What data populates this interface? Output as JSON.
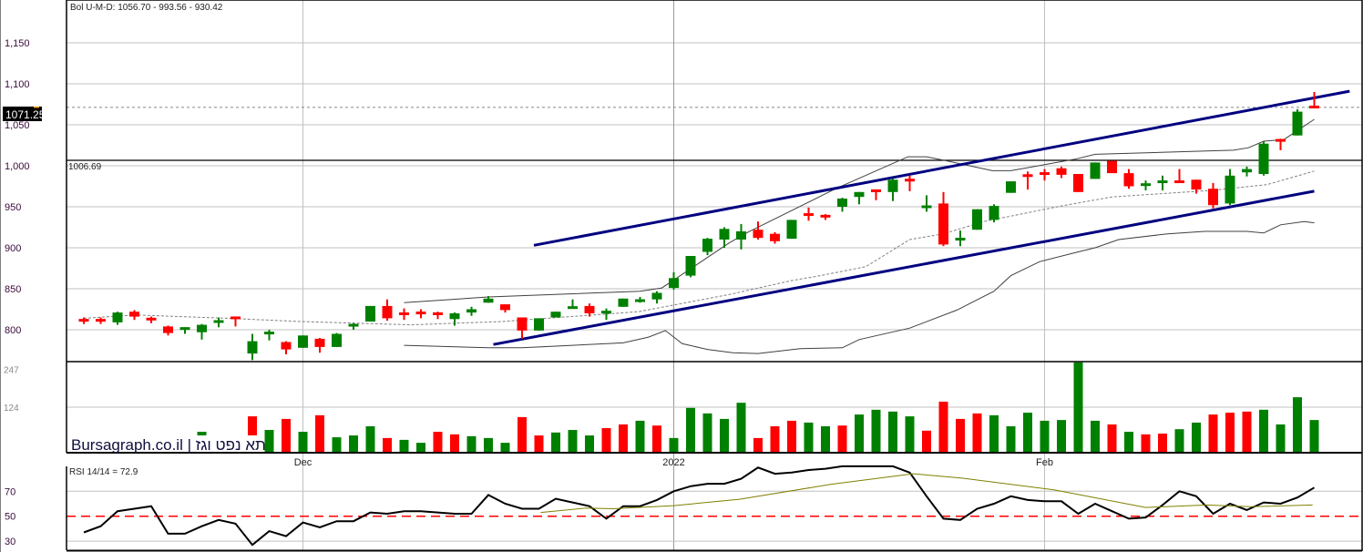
{
  "chart_data": {
    "type": "candlestick",
    "header_label": "Bol U-M-D: 1056.70 - 993.56 - 930.42",
    "watermark": "Bursagraph.co.il | תא נפט וגז",
    "last_price_label": "1071.25",
    "last_price": 1071.25,
    "reference_line_label": "1006.69",
    "reference_line": 1006.69,
    "price_axis": {
      "ylim": [
        761,
        1202
      ],
      "ticks": [
        800,
        850,
        900,
        950,
        1000,
        1050,
        1100,
        1150
      ],
      "tick_labels": [
        "800",
        "850",
        "900",
        "950",
        "1,000",
        "1,050",
        "1,100",
        "1,150"
      ],
      "grid": true
    },
    "x_labels": [
      {
        "index": 14,
        "label": "Dec"
      },
      {
        "index": 36,
        "label": "2022"
      },
      {
        "index": 58,
        "label": "Feb"
      }
    ],
    "ohlc": [
      [
        812,
        815,
        807,
        811
      ],
      [
        812,
        815,
        807,
        811
      ],
      [
        809,
        822,
        806,
        821
      ],
      [
        822,
        824,
        812,
        816
      ],
      [
        814,
        816,
        808,
        812
      ],
      [
        804,
        805,
        793,
        796
      ],
      [
        800,
        803,
        795,
        803
      ],
      [
        797,
        807,
        788,
        806
      ],
      [
        809,
        815,
        803,
        811
      ],
      [
        815,
        815,
        804,
        814
      ],
      [
        771,
        795,
        763,
        786
      ],
      [
        795,
        800,
        787,
        797
      ],
      [
        785,
        786,
        770,
        776
      ],
      [
        778,
        793,
        778,
        793
      ],
      [
        789,
        790,
        772,
        779
      ],
      [
        779,
        796,
        779,
        795
      ],
      [
        804,
        808,
        800,
        807
      ],
      [
        810,
        829,
        810,
        829
      ],
      [
        829,
        837,
        811,
        814
      ],
      [
        820,
        826,
        812,
        819
      ],
      [
        821,
        825,
        814,
        820
      ],
      [
        820,
        822,
        813,
        819
      ],
      [
        813,
        821,
        805,
        820
      ],
      [
        821,
        828,
        817,
        825
      ],
      [
        833,
        841,
        833,
        838
      ],
      [
        831,
        831,
        821,
        824
      ],
      [
        815,
        815,
        789,
        799
      ],
      [
        799,
        814,
        799,
        814
      ],
      [
        815,
        822,
        815,
        822
      ],
      [
        826,
        837,
        826,
        828
      ],
      [
        829,
        832,
        816,
        820
      ],
      [
        821,
        826,
        812,
        822
      ],
      [
        828,
        838,
        828,
        838
      ],
      [
        835,
        840,
        833,
        836
      ],
      [
        837,
        847,
        832,
        845
      ],
      [
        851,
        870,
        849,
        863
      ],
      [
        866,
        890,
        864,
        890
      ],
      [
        895,
        912,
        891,
        911
      ],
      [
        910,
        925,
        900,
        923
      ],
      [
        910,
        929,
        898,
        920
      ],
      [
        922,
        932,
        910,
        912
      ],
      [
        917,
        919,
        905,
        908
      ],
      [
        911,
        934,
        911,
        934
      ],
      [
        941,
        949,
        933,
        940
      ],
      [
        939,
        941,
        934,
        938
      ],
      [
        950,
        961,
        944,
        960
      ],
      [
        962,
        968,
        953,
        968
      ],
      [
        971,
        971,
        958,
        968
      ],
      [
        968,
        984,
        957,
        983
      ],
      [
        984,
        988,
        969,
        981
      ],
      [
        949,
        964,
        944,
        951
      ],
      [
        954,
        968,
        902,
        904
      ],
      [
        909,
        921,
        902,
        912
      ],
      [
        922,
        947,
        922,
        947
      ],
      [
        934,
        953,
        931,
        951
      ],
      [
        967,
        981,
        967,
        981
      ],
      [
        989,
        993,
        971,
        987
      ],
      [
        992,
        996,
        982,
        989
      ],
      [
        997,
        999,
        985,
        989
      ],
      [
        990,
        990,
        968,
        968
      ],
      [
        984,
        1004,
        984,
        1004
      ],
      [
        1006,
        1006,
        991,
        991
      ],
      [
        991,
        996,
        972,
        975
      ],
      [
        976,
        982,
        970,
        978
      ],
      [
        979,
        988,
        970,
        982
      ],
      [
        982,
        996,
        979,
        979
      ],
      [
        983,
        983,
        966,
        971
      ],
      [
        972,
        979,
        948,
        952
      ],
      [
        954,
        996,
        952,
        988
      ],
      [
        992,
        999,
        987,
        996
      ],
      [
        990,
        1030,
        988,
        1027
      ],
      [
        1032,
        1033,
        1019,
        1030
      ],
      [
        1037,
        1069,
        1037,
        1066
      ],
      [
        1072,
        1090,
        1071,
        1071.25
      ]
    ],
    "bollinger": {
      "upper": [
        [
          20,
          833
        ],
        [
          25,
          840
        ],
        [
          34,
          847
        ],
        [
          35.3,
          851
        ],
        [
          39.3,
          906
        ],
        [
          40.4,
          919
        ],
        [
          45.6,
          972
        ],
        [
          49.9,
          1011
        ],
        [
          51,
          1011
        ],
        [
          52.2,
          1006
        ],
        [
          54.9,
          994
        ],
        [
          56,
          994
        ],
        [
          59.8,
          1008
        ],
        [
          61,
          1014
        ],
        [
          69.2,
          1019
        ],
        [
          70.1,
          1022
        ],
        [
          71,
          1030
        ],
        [
          72.2,
          1032
        ],
        [
          74,
          1056.7
        ]
      ],
      "middle": [
        [
          1,
          814
        ],
        [
          4.1,
          818
        ],
        [
          9.5,
          814
        ],
        [
          13.9,
          810
        ],
        [
          20.4,
          806
        ],
        [
          25.8,
          810
        ],
        [
          33.9,
          822
        ],
        [
          39.3,
          843
        ],
        [
          43,
          860
        ],
        [
          44.7,
          866
        ],
        [
          47.4,
          877
        ],
        [
          50,
          910
        ],
        [
          52,
          917
        ],
        [
          54.4,
          932
        ],
        [
          59,
          951
        ],
        [
          62,
          962
        ],
        [
          67.9,
          970
        ],
        [
          71.2,
          977
        ],
        [
          74,
          993.56
        ]
      ],
      "lower": [
        [
          20,
          781
        ],
        [
          25,
          778
        ],
        [
          27,
          778
        ],
        [
          33,
          784
        ],
        [
          34.5,
          791
        ],
        [
          35.5,
          799
        ],
        [
          36.5,
          783
        ],
        [
          38,
          776
        ],
        [
          39.5,
          772
        ],
        [
          41,
          771
        ],
        [
          43.5,
          777
        ],
        [
          46,
          778
        ],
        [
          47,
          788
        ],
        [
          50,
          802
        ],
        [
          52.8,
          824
        ],
        [
          55,
          847
        ],
        [
          56,
          866
        ],
        [
          57.7,
          883
        ],
        [
          60,
          895
        ],
        [
          61,
          900
        ],
        [
          62.4,
          910
        ],
        [
          65.3,
          917
        ],
        [
          67.5,
          920
        ],
        [
          70,
          920
        ],
        [
          71,
          918
        ],
        [
          72,
          928
        ],
        [
          73.4,
          932
        ],
        [
          74,
          930.42
        ]
      ]
    },
    "trend_channel": {
      "upper": [
        [
          27.7,
          903
        ],
        [
          76.1,
          1091
        ]
      ],
      "lower": [
        [
          25.3,
          782
        ],
        [
          74,
          969
        ]
      ]
    },
    "volume": {
      "ticks": [
        124,
        247
      ],
      "tick_labels": [
        "124",
        "247"
      ],
      "values": [
        null,
        null,
        null,
        null,
        null,
        null,
        null,
        57,
        null,
        null,
        99,
        62,
        92,
        57,
        102,
        42,
        47,
        72,
        40,
        35,
        27,
        57,
        50,
        45,
        40,
        27,
        97,
        47,
        55,
        62,
        47,
        67,
        77,
        87,
        74,
        40,
        122,
        107,
        92,
        136,
        40,
        72,
        87,
        82,
        72,
        74,
        104,
        117,
        112,
        99,
        60,
        139,
        92,
        107,
        102,
        72,
        109,
        87,
        89,
        246,
        87,
        77,
        57,
        50,
        52,
        64,
        82,
        104,
        109,
        112,
        117,
        77,
        151,
        89
      ],
      "direction": "uuuuuuuuuudududuuuduudduuudduuudduduuuuuddduuduuuudddduuuuuuududduuddduuuuuu"
    },
    "rsi": {
      "label": "RSI 14/14 = 72.9",
      "ticks": [
        30,
        50,
        70
      ],
      "tick_labels": [
        "30",
        "50",
        "70"
      ],
      "ylim": [
        21,
        96
      ],
      "values": [
        37,
        42,
        54,
        56,
        58,
        36,
        36,
        42,
        47,
        44,
        27,
        38,
        34,
        45,
        41,
        46,
        46,
        53,
        52,
        54,
        54,
        53,
        52,
        52,
        67,
        60,
        56,
        56,
        64,
        61,
        58,
        48,
        58,
        58,
        63,
        70,
        74,
        76,
        76,
        80,
        89,
        84,
        85,
        87,
        88,
        90,
        90,
        90,
        90,
        85,
        66,
        48,
        47,
        56,
        60,
        66,
        63,
        62,
        62,
        52,
        60,
        54,
        48,
        49,
        59,
        70,
        66,
        52,
        60,
        55,
        61,
        60,
        65,
        72.9
      ],
      "signal": [
        [
          28.1,
          53
        ],
        [
          30.8,
          56.5
        ],
        [
          32.4,
          56
        ],
        [
          36,
          58.5
        ],
        [
          39.9,
          63.6
        ],
        [
          45.3,
          75.5
        ],
        [
          50.2,
          84
        ],
        [
          53.1,
          80.5
        ],
        [
          58.6,
          71
        ],
        [
          64,
          57
        ],
        [
          67.6,
          59
        ],
        [
          70.2,
          57.6
        ],
        [
          73.9,
          59
        ]
      ]
    },
    "colors": {
      "up": "#008000",
      "down": "#ff0000",
      "channel": "#000080",
      "band": "#404040",
      "band_mid": "#808080",
      "rsi": "#000000",
      "rsi_signal": "#808000",
      "rsi_mid": "#ff0000",
      "grid": "#c0c0c0"
    }
  }
}
